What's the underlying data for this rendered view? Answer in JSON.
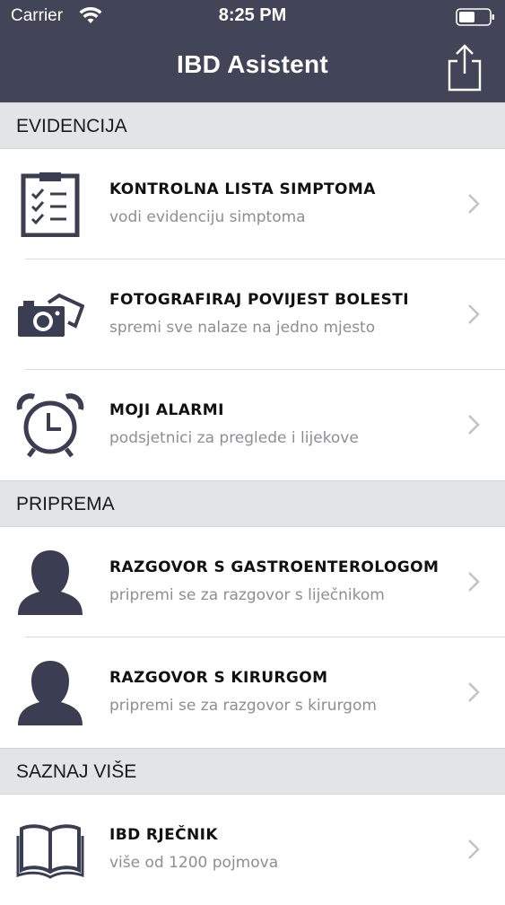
{
  "status_bar": {
    "carrier": "Carrier",
    "time": "8:25 PM"
  },
  "nav_bar": {
    "title": "IBD Asistent"
  },
  "colors": {
    "bar": "#424558",
    "icon": "#3b3e52",
    "section_bg": "#e3e4e6",
    "subtitle": "#8e8e93"
  },
  "sections": [
    {
      "header": "EVIDENCIJA",
      "items": [
        {
          "title": "KONTROLNA LISTA SIMPTOMA",
          "subtitle": "vodi evidenciju simptoma",
          "icon": "checklist-icon"
        },
        {
          "title": "FOTOGRAFIRAJ POVIJEST BOLESTI",
          "subtitle": "spremi sve nalaze na jedno mjesto",
          "icon": "camera-icon"
        },
        {
          "title": "MOJI ALARMI",
          "subtitle": "podsjetnici za preglede i lijekove",
          "icon": "alarm-clock-icon"
        }
      ]
    },
    {
      "header": "PRIPREMA",
      "items": [
        {
          "title": "RAZGOVOR S GASTROENTEROLOGOM",
          "subtitle": "pripremi se za razgovor s liječnikom",
          "icon": "person-icon"
        },
        {
          "title": "RAZGOVOR S KIRURGOM",
          "subtitle": "pripremi se za razgovor s kirurgom",
          "icon": "person-icon"
        }
      ]
    },
    {
      "header": "SAZNAJ VIŠE",
      "items": [
        {
          "title": "IBD RJEČNIK",
          "subtitle": "više od 1200 pojmova",
          "icon": "book-icon"
        }
      ]
    }
  ]
}
